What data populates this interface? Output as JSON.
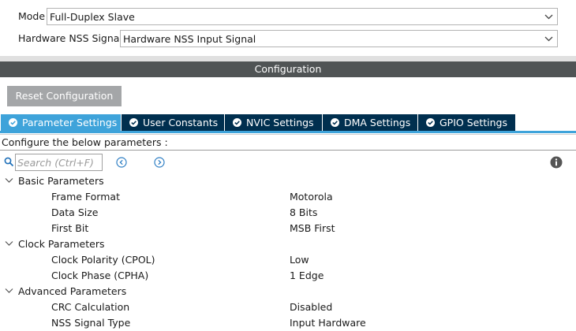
{
  "mode": {
    "label": "Mode",
    "value": "Full-Duplex Slave"
  },
  "nss": {
    "label": "Hardware NSS Signal",
    "value": "Hardware NSS Input Signal"
  },
  "config_header": "Configuration",
  "reset_button": "Reset Configuration",
  "tabs": [
    {
      "label": "Parameter Settings",
      "active": true
    },
    {
      "label": "User Constants"
    },
    {
      "label": "NVIC Settings"
    },
    {
      "label": "DMA Settings"
    },
    {
      "label": "GPIO Settings"
    }
  ],
  "configure_text": "Configure the below parameters :",
  "search": {
    "placeholder": "Search (Ctrl+F)"
  },
  "groups": [
    {
      "label": "Basic Parameters",
      "params": [
        {
          "name": "Frame Format",
          "value": "Motorola"
        },
        {
          "name": "Data Size",
          "value": "8 Bits"
        },
        {
          "name": "First Bit",
          "value": "MSB First"
        }
      ]
    },
    {
      "label": "Clock Parameters",
      "params": [
        {
          "name": "Clock Polarity (CPOL)",
          "value": "Low"
        },
        {
          "name": "Clock Phase (CPHA)",
          "value": "1 Edge"
        }
      ]
    },
    {
      "label": "Advanced Parameters",
      "params": [
        {
          "name": "CRC Calculation",
          "value": "Disabled"
        },
        {
          "name": "NSS Signal Type",
          "value": "Input Hardware"
        }
      ]
    }
  ],
  "colors": {
    "tab_active": "#3ea3da",
    "tab_inactive": "#002f4f",
    "header_bar": "#505455",
    "reset_button": "#a4a6a8"
  }
}
